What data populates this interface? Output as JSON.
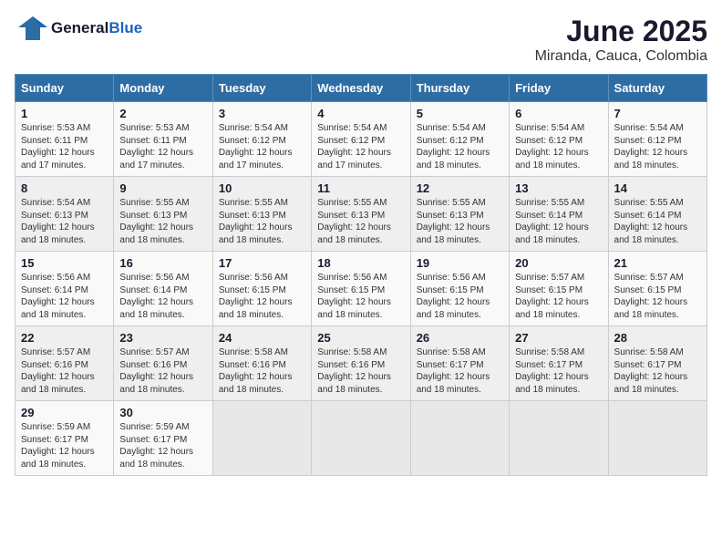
{
  "logo": {
    "general": "General",
    "blue": "Blue"
  },
  "title": "June 2025",
  "subtitle": "Miranda, Cauca, Colombia",
  "days_of_week": [
    "Sunday",
    "Monday",
    "Tuesday",
    "Wednesday",
    "Thursday",
    "Friday",
    "Saturday"
  ],
  "weeks": [
    [
      {
        "day": "1",
        "rise": "5:53 AM",
        "set": "6:11 PM",
        "daylight": "12 hours and 17 minutes."
      },
      {
        "day": "2",
        "rise": "5:53 AM",
        "set": "6:11 PM",
        "daylight": "12 hours and 17 minutes."
      },
      {
        "day": "3",
        "rise": "5:54 AM",
        "set": "6:12 PM",
        "daylight": "12 hours and 17 minutes."
      },
      {
        "day": "4",
        "rise": "5:54 AM",
        "set": "6:12 PM",
        "daylight": "12 hours and 17 minutes."
      },
      {
        "day": "5",
        "rise": "5:54 AM",
        "set": "6:12 PM",
        "daylight": "12 hours and 18 minutes."
      },
      {
        "day": "6",
        "rise": "5:54 AM",
        "set": "6:12 PM",
        "daylight": "12 hours and 18 minutes."
      },
      {
        "day": "7",
        "rise": "5:54 AM",
        "set": "6:12 PM",
        "daylight": "12 hours and 18 minutes."
      }
    ],
    [
      {
        "day": "8",
        "rise": "5:54 AM",
        "set": "6:13 PM",
        "daylight": "12 hours and 18 minutes."
      },
      {
        "day": "9",
        "rise": "5:55 AM",
        "set": "6:13 PM",
        "daylight": "12 hours and 18 minutes."
      },
      {
        "day": "10",
        "rise": "5:55 AM",
        "set": "6:13 PM",
        "daylight": "12 hours and 18 minutes."
      },
      {
        "day": "11",
        "rise": "5:55 AM",
        "set": "6:13 PM",
        "daylight": "12 hours and 18 minutes."
      },
      {
        "day": "12",
        "rise": "5:55 AM",
        "set": "6:13 PM",
        "daylight": "12 hours and 18 minutes."
      },
      {
        "day": "13",
        "rise": "5:55 AM",
        "set": "6:14 PM",
        "daylight": "12 hours and 18 minutes."
      },
      {
        "day": "14",
        "rise": "5:55 AM",
        "set": "6:14 PM",
        "daylight": "12 hours and 18 minutes."
      }
    ],
    [
      {
        "day": "15",
        "rise": "5:56 AM",
        "set": "6:14 PM",
        "daylight": "12 hours and 18 minutes."
      },
      {
        "day": "16",
        "rise": "5:56 AM",
        "set": "6:14 PM",
        "daylight": "12 hours and 18 minutes."
      },
      {
        "day": "17",
        "rise": "5:56 AM",
        "set": "6:15 PM",
        "daylight": "12 hours and 18 minutes."
      },
      {
        "day": "18",
        "rise": "5:56 AM",
        "set": "6:15 PM",
        "daylight": "12 hours and 18 minutes."
      },
      {
        "day": "19",
        "rise": "5:56 AM",
        "set": "6:15 PM",
        "daylight": "12 hours and 18 minutes."
      },
      {
        "day": "20",
        "rise": "5:57 AM",
        "set": "6:15 PM",
        "daylight": "12 hours and 18 minutes."
      },
      {
        "day": "21",
        "rise": "5:57 AM",
        "set": "6:15 PM",
        "daylight": "12 hours and 18 minutes."
      }
    ],
    [
      {
        "day": "22",
        "rise": "5:57 AM",
        "set": "6:16 PM",
        "daylight": "12 hours and 18 minutes."
      },
      {
        "day": "23",
        "rise": "5:57 AM",
        "set": "6:16 PM",
        "daylight": "12 hours and 18 minutes."
      },
      {
        "day": "24",
        "rise": "5:58 AM",
        "set": "6:16 PM",
        "daylight": "12 hours and 18 minutes."
      },
      {
        "day": "25",
        "rise": "5:58 AM",
        "set": "6:16 PM",
        "daylight": "12 hours and 18 minutes."
      },
      {
        "day": "26",
        "rise": "5:58 AM",
        "set": "6:17 PM",
        "daylight": "12 hours and 18 minutes."
      },
      {
        "day": "27",
        "rise": "5:58 AM",
        "set": "6:17 PM",
        "daylight": "12 hours and 18 minutes."
      },
      {
        "day": "28",
        "rise": "5:58 AM",
        "set": "6:17 PM",
        "daylight": "12 hours and 18 minutes."
      }
    ],
    [
      {
        "day": "29",
        "rise": "5:59 AM",
        "set": "6:17 PM",
        "daylight": "12 hours and 18 minutes."
      },
      {
        "day": "30",
        "rise": "5:59 AM",
        "set": "6:17 PM",
        "daylight": "12 hours and 18 minutes."
      },
      null,
      null,
      null,
      null,
      null
    ]
  ]
}
